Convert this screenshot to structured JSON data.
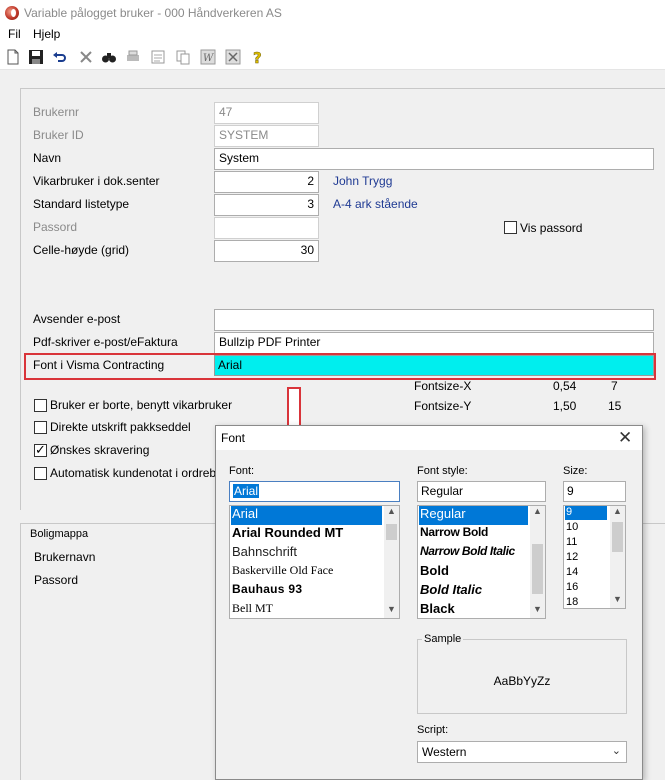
{
  "window": {
    "title": "Variable pålogget bruker - 000 Håndverkeren AS"
  },
  "menu": {
    "file": "Fil",
    "help": "Hjelp"
  },
  "toolbar": {
    "icons": [
      "new-icon",
      "save-icon",
      "undo-icon",
      "delete-icon",
      "find-icon",
      "print-icon",
      "preview-icon",
      "copy-icon",
      "word-icon",
      "excel-icon",
      "help-icon"
    ]
  },
  "form": {
    "brukernr_label": "Brukernr",
    "brukernr_value": "47",
    "brukerid_label": "Bruker ID",
    "brukerid_value": "SYSTEM",
    "navn_label": "Navn",
    "navn_value": "System",
    "vikar_label": "Vikarbruker i dok.senter",
    "vikar_value": "2",
    "vikar_name": "John Trygg",
    "liste_label": "Standard listetype",
    "liste_value": "3",
    "liste_name": "A-4 ark stående",
    "passord_label": "Passord",
    "vis_passord_label": "Vis passord",
    "celle_label": "Celle-høyde (grid)",
    "celle_value": "30",
    "avsender_label": "Avsender e-post",
    "avsender_value": "",
    "pdf_label": "Pdf-skriver e-post/eFaktura",
    "pdf_value": "Bullzip PDF Printer",
    "font_label": "Font i Visma Contracting",
    "font_value": "Arial",
    "fontsize_x_label": "Fontsize-X",
    "fontsize_x_v1": "0,54",
    "fontsize_x_v2": "7",
    "fontsize_y_label": "Fontsize-Y",
    "fontsize_y_v1": "1,50",
    "fontsize_y_v2": "15",
    "cb_borte_label": "Bruker er borte, benytt vikarbruker",
    "cb_direkte_label": "Direkte utskrift pakkseddel",
    "cb_skravering_label": "Ønskes skravering",
    "cb_kundenotat_label": "Automatisk kundenotat i ordreb"
  },
  "boligmappa": {
    "title": "Boligmappa",
    "brukernavn_label": "Brukernavn",
    "passord_label": "Passord"
  },
  "font_dialog": {
    "title": "Font",
    "font_label": "Font:",
    "font_value": "Arial",
    "fonts": [
      "Arial",
      "Arial Rounded MT",
      "Bahnschrift",
      "Baskerville Old Face",
      "Bauhaus 93",
      "Bell MT"
    ],
    "style_label": "Font style:",
    "style_value": "Regular",
    "styles": [
      "Regular",
      "Narrow Bold",
      "Narrow Bold Italic",
      "Bold",
      "Bold Italic",
      "Black"
    ],
    "size_label": "Size:",
    "size_value": "9",
    "sizes": [
      "9",
      "10",
      "11",
      "12",
      "14",
      "16",
      "18"
    ],
    "sample_label": "Sample",
    "sample_text": "AaBbYyZz",
    "script_label": "Script:",
    "script_value": "Western"
  },
  "colors": {
    "highlight": "#d9343a",
    "font_field_bg": "#00eeee",
    "selection": "#0078d7",
    "link": "#1f3a93"
  }
}
